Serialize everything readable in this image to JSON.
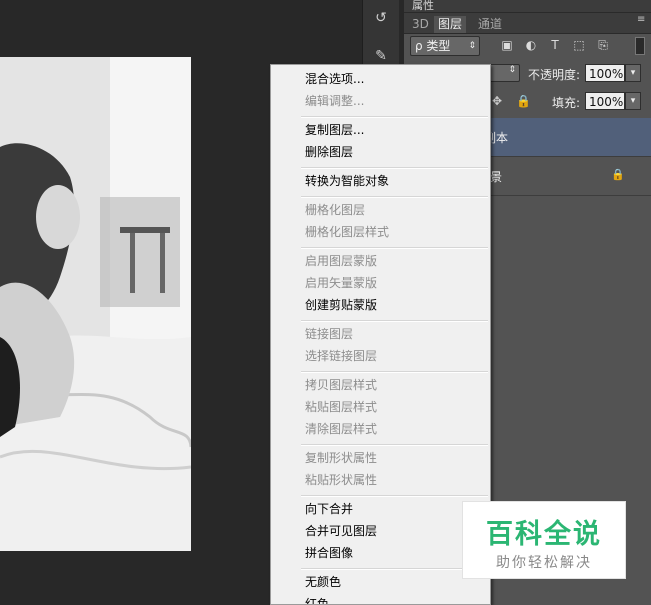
{
  "panel": {
    "title": "属性",
    "tabs": [
      "3D",
      "图层",
      "通道"
    ],
    "filter": {
      "label": "ρ 类型"
    },
    "opacity": {
      "label": "不透明度:",
      "value": "100%"
    },
    "fill": {
      "label": "填充:",
      "value": "100%"
    },
    "layers": [
      {
        "name": "副本",
        "selected": true
      },
      {
        "name": "景",
        "locked": true,
        "selected": false
      }
    ]
  },
  "context_menu": {
    "items": [
      {
        "label": "混合选项...",
        "enabled": true
      },
      {
        "label": "编辑调整...",
        "enabled": false
      },
      {
        "separator": true
      },
      {
        "label": "复制图层...",
        "enabled": true
      },
      {
        "label": "删除图层",
        "enabled": true
      },
      {
        "separator": true
      },
      {
        "label": "转换为智能对象",
        "enabled": true
      },
      {
        "separator": true
      },
      {
        "label": "栅格化图层",
        "enabled": false
      },
      {
        "label": "栅格化图层样式",
        "enabled": false
      },
      {
        "separator": true
      },
      {
        "label": "启用图层蒙版",
        "enabled": false
      },
      {
        "label": "启用矢量蒙版",
        "enabled": false
      },
      {
        "label": "创建剪贴蒙版",
        "enabled": true
      },
      {
        "separator": true
      },
      {
        "label": "链接图层",
        "enabled": false
      },
      {
        "label": "选择链接图层",
        "enabled": false
      },
      {
        "separator": true
      },
      {
        "label": "拷贝图层样式",
        "enabled": false
      },
      {
        "label": "粘贴图层样式",
        "enabled": false
      },
      {
        "label": "清除图层样式",
        "enabled": false
      },
      {
        "separator": true
      },
      {
        "label": "复制形状属性",
        "enabled": false
      },
      {
        "label": "粘贴形状属性",
        "enabled": false
      },
      {
        "separator": true
      },
      {
        "label": "向下合并",
        "enabled": true
      },
      {
        "label": "合并可见图层",
        "enabled": true
      },
      {
        "label": "拼合图像",
        "enabled": true
      },
      {
        "separator": true
      },
      {
        "label": "无颜色",
        "enabled": true
      },
      {
        "label": "红色",
        "enabled": true
      }
    ]
  },
  "watermark": {
    "title": "百科全说",
    "subtitle": "助你轻松解决"
  }
}
